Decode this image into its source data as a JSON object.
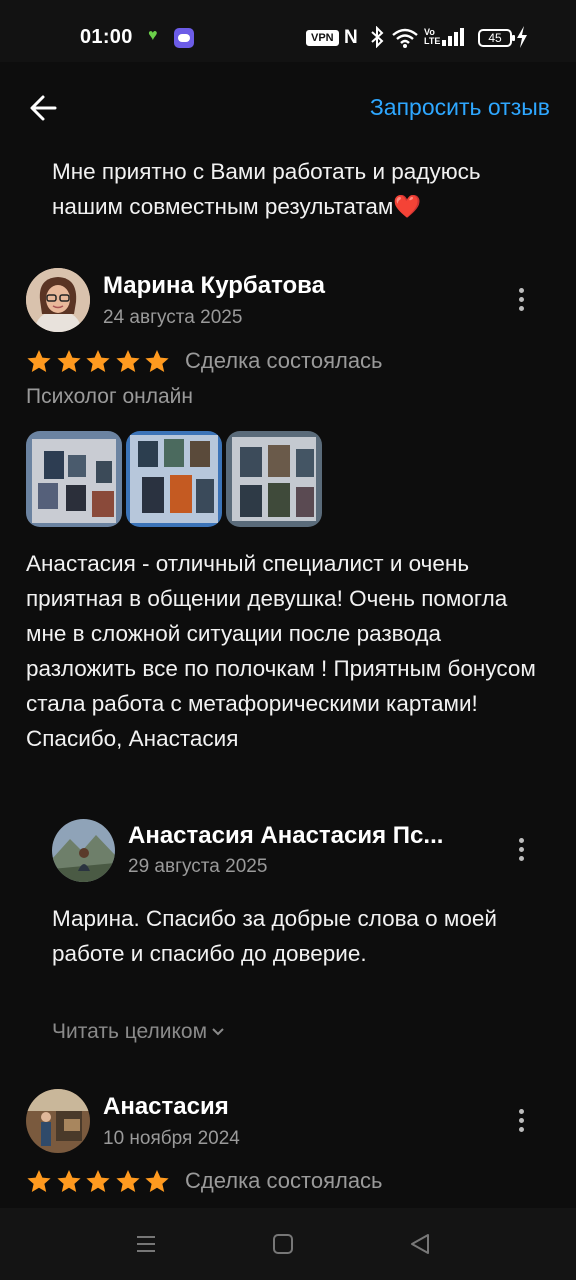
{
  "status_bar": {
    "time": "01:00",
    "vpn_label": "VPN",
    "nfc_label": "N",
    "volte_label": "Vo\nLTE",
    "battery_level": "45",
    "icons": [
      "heart-icon",
      "app-notification-icon",
      "vpn-icon",
      "nfc-icon",
      "bluetooth-icon",
      "wifi-icon",
      "volte-icon",
      "signal-icon",
      "battery-icon",
      "charging-icon"
    ]
  },
  "app_bar": {
    "back_icon": "arrow-left-icon",
    "request_review_label": "Запросить отзыв"
  },
  "previous_review_tail": {
    "text": "Мне приятно с Вами работать и радуюсь нашим совместным результатам❤️"
  },
  "review_1": {
    "author_name": "Марина Курбатова",
    "date": "24 августа 2025",
    "rating": 5,
    "rating_max": 5,
    "deal_status": "Сделка состоялась",
    "service": "Психолог онлайн",
    "photos_count": 3,
    "text": "Анастасия - отличный специалист и очень приятная в общении девушка! Очень помогла мне в сложной ситуации после развода разложить все по полочкам ! Приятным бонусом стала работа с метафорическими картами! Спасибо, Анастасия",
    "reply": {
      "author_name": "Анастасия Анастасия Пс...",
      "date": "29 августа 2025",
      "text": "Марина. Спасибо за добрые слова о моей работе и спасибо до доверие."
    },
    "read_more_label": "Читать целиком"
  },
  "review_2": {
    "author_name": "Анастасия",
    "date": "10 ноября 2024",
    "rating": 5,
    "rating_max": 5,
    "deal_status": "Сделка состоялась"
  },
  "colors": {
    "background": "#0d0d0d",
    "accent_link": "#2ea7ff",
    "star": "#ff9a1f",
    "secondary_text": "#9a9a9a"
  },
  "nav_bar": {
    "icons": [
      "menu-icon",
      "home-square-icon",
      "back-triangle-icon"
    ]
  }
}
